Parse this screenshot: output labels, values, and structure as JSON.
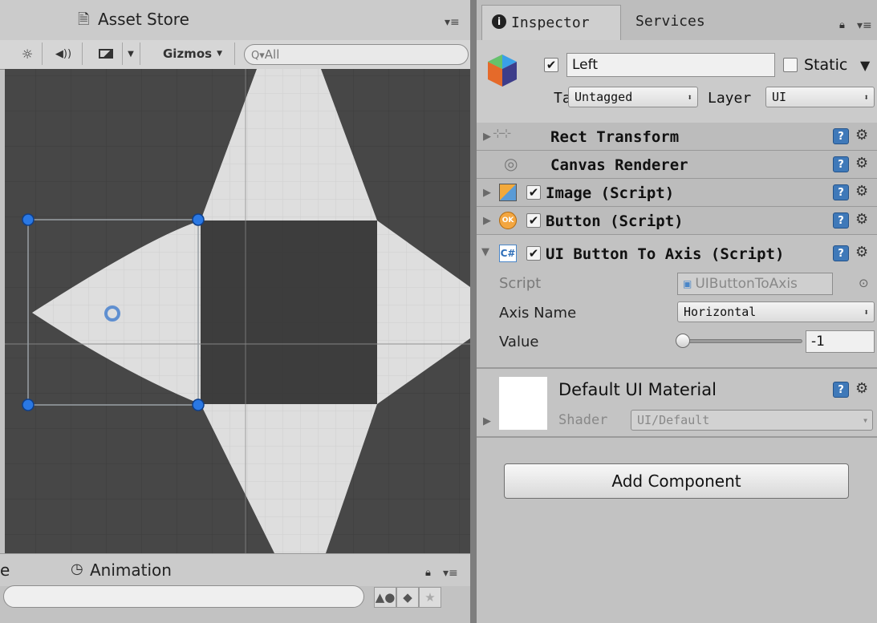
{
  "scene": {
    "tab_title": "Asset Store",
    "toolbar": {
      "sun_icon": "☼",
      "audio_icon": "◀))",
      "image_icon": "▭",
      "gizmos_label": "Gizmos",
      "search_placeholder": "All"
    }
  },
  "bottom": {
    "partial_tab": "e",
    "tab_title": "Animation"
  },
  "inspector": {
    "tabs": [
      {
        "label": "Inspector"
      },
      {
        "label": "Services"
      }
    ],
    "object": {
      "enabled": true,
      "name": "Left",
      "static_label": "Static",
      "tag_label": "Tag",
      "tag_value": "Untagged",
      "layer_label": "Layer",
      "layer_value": "UI"
    },
    "components": [
      {
        "title": "Rect Transform"
      },
      {
        "title": "Canvas Renderer"
      },
      {
        "title": "Image (Script)"
      },
      {
        "title": "Button (Script)"
      },
      {
        "title": "UI Button To Axis (Script)"
      }
    ],
    "script_props": {
      "script_label": "Script",
      "script_value": "UIButtonToAxis",
      "axis_label": "Axis Name",
      "axis_value": "Horizontal",
      "value_label": "Value",
      "value_value": "-1",
      "slider_fraction": 0.0
    },
    "material": {
      "name": "Default UI Material",
      "shader_label": "Shader",
      "shader_value": "UI/Default"
    },
    "add_component_label": "Add Component"
  },
  "colors": {
    "handle_blue": "#2a78e4",
    "help_blue": "#3f79b9",
    "viewport_bg": "#474747"
  }
}
